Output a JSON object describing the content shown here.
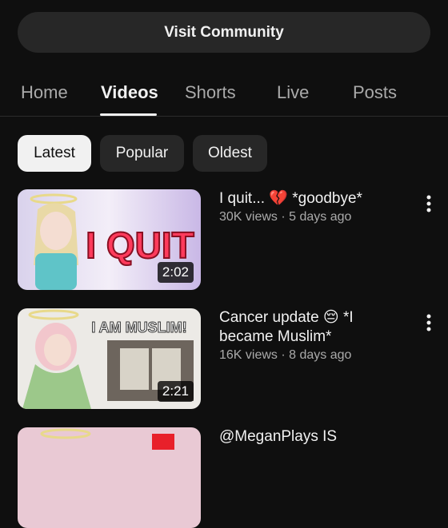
{
  "visit_community": "Visit Community",
  "tabs": [
    {
      "label": "Home"
    },
    {
      "label": "Videos"
    },
    {
      "label": "Shorts"
    },
    {
      "label": "Live"
    },
    {
      "label": "Posts"
    }
  ],
  "active_tab": "Videos",
  "filters": [
    {
      "label": "Latest"
    },
    {
      "label": "Popular"
    },
    {
      "label": "Oldest"
    }
  ],
  "selected_filter": "Latest",
  "videos": [
    {
      "title": "I quit... 💔 *goodbye*",
      "views": "30K views",
      "age": "5 days ago",
      "meta": "30K views · 5 days ago",
      "duration": "2:02",
      "thumb_text": "I QUIT"
    },
    {
      "title": "Cancer update 😔 *I became Muslim*",
      "views": "16K views",
      "age": "8 days ago",
      "meta": "16K views · 8 days ago",
      "duration": "2:21",
      "thumb_text": "I AM MUSLIM!"
    },
    {
      "title": "@MeganPlays IS"
    }
  ],
  "colors": {
    "background": "#0f0f0f",
    "surface": "#272727",
    "text": "#f1f1f1",
    "secondary_text": "#aaaaaa"
  }
}
